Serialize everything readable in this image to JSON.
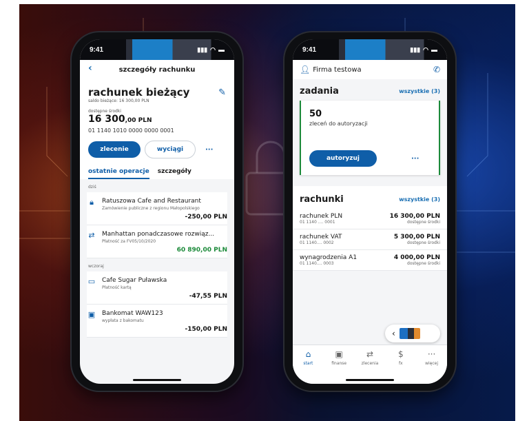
{
  "status": {
    "time": "9:41"
  },
  "left": {
    "nav_title": "szczegóły rachunku",
    "account_title": "rachunek bieżący",
    "saldo": "saldo bieżące: 16 300,00 PLN",
    "available_label": "dostępne środki",
    "available_main": "16 300",
    "available_dec": ",00 PLN",
    "iban": "01 1140 1010 0000 0000 0001",
    "btn_order": "zlecenie",
    "btn_statements": "wyciągi",
    "more": "···",
    "tab1": "ostatnie operacje",
    "tab2": "szczegóły",
    "day_today": "dziś",
    "day_yesterday": "wczoraj",
    "ops": [
      {
        "title": "Ratuszowa Cafe and Restaurant",
        "sub": "Zamówienie publiczne z regionu Małopolskiego",
        "amount": "-250,00 PLN",
        "icon": "lock-icon"
      },
      {
        "title": "Manhattan ponadczasowe rozwiąz...",
        "sub": "Płatność za FV05/10/2020",
        "amount": "60 890,00 PLN",
        "icon": "transfer-icon"
      },
      {
        "title": "Cafe Sugar Puławska",
        "sub": "Płatność kartą",
        "amount": "-47,55 PLN",
        "icon": "card-icon"
      },
      {
        "title": "Bankomat WAW123",
        "sub": "wypłata z bakomatu",
        "amount": "-150,00 PLN",
        "icon": "wallet-icon"
      }
    ]
  },
  "right": {
    "company": "Firma testowa",
    "tasks_title": "zadania",
    "all_tasks": "wszystkie (3)",
    "count": "50",
    "count_label": "zleceń do autoryzacji",
    "authorize": "autoryzuj",
    "more": "···",
    "accounts_title": "rachunki",
    "all_accounts": "wszystkie (3)",
    "accounts": [
      {
        "name": "rachunek PLN",
        "num": "01 1140 .... 0001",
        "value": "16 300,00 PLN",
        "note": "dostępne środki"
      },
      {
        "name": "rachunek VAT",
        "num": "01 1140.... 0002",
        "value": "5 300,00 PLN",
        "note": "dostępne środki"
      },
      {
        "name": "wynagrodzenia A1",
        "num": "01 1140.... 0003",
        "value": "4 000,00 PLN",
        "note": "dostępne środki"
      }
    ],
    "tabbar": [
      {
        "label": "start",
        "icon": "home-icon"
      },
      {
        "label": "finanse",
        "icon": "wallet-icon"
      },
      {
        "label": "zlecenia",
        "icon": "transfer-icon"
      },
      {
        "label": "fx",
        "icon": "fx-icon"
      },
      {
        "label": "więcej",
        "icon": "more-icon"
      }
    ]
  },
  "colors": {
    "accent": "#0f5ea8",
    "positive": "#1c8a3a"
  }
}
